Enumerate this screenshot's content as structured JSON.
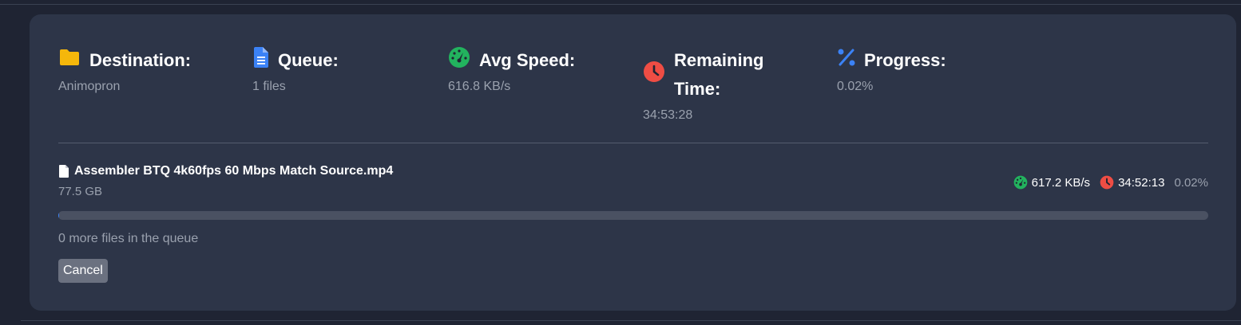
{
  "stats": {
    "destination": {
      "label": "Destination:",
      "value": "Animopron",
      "icon": "folder-icon",
      "color": "#f5b70b"
    },
    "queue": {
      "label": "Queue:",
      "value": "1 files",
      "icon": "document-icon",
      "color": "#3b82f6"
    },
    "avg_speed": {
      "label": "Avg Speed:",
      "value": "616.8 KB/s",
      "icon": "speedometer-icon",
      "color": "#22b35e"
    },
    "remaining_time": {
      "label_line1": "Remaining",
      "label_line2": "Time:",
      "value": "34:53:28",
      "icon": "clock-icon",
      "color": "#ef4d44"
    },
    "progress": {
      "label": "Progress:",
      "value": "0.02%",
      "icon": "percent-icon",
      "color": "#3b82f6"
    }
  },
  "file": {
    "name": "Assembler BTQ 4k60fps 60 Mbps Match Source.mp4",
    "size": "77.5 GB",
    "speed": "617.2 KB/s",
    "time_left": "34:52:13",
    "percent": "0.02%",
    "progress_fraction": 0.0002
  },
  "queue_note": "0 more files in the queue",
  "cancel_label": "Cancel"
}
